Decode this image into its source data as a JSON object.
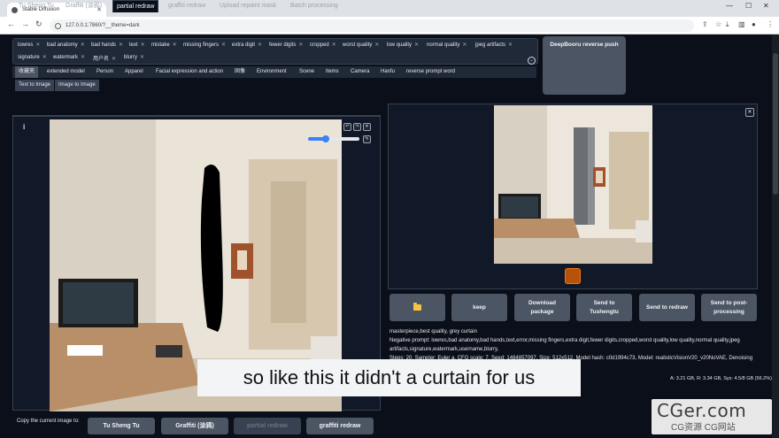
{
  "browser": {
    "tab_title": "Stable Diffusion",
    "url": "127.0.0.1:7860/?__theme=dark"
  },
  "prompt_tags": [
    {
      "label": "lowres"
    },
    {
      "label": "bad anatomy"
    },
    {
      "label": "bad hands"
    },
    {
      "label": "text"
    },
    {
      "label": "mistake"
    },
    {
      "label": "missing fingers"
    },
    {
      "label": "extra digit"
    },
    {
      "label": "fewer digits"
    },
    {
      "label": "cropped"
    },
    {
      "label": "worst quality"
    },
    {
      "label": "low quality"
    },
    {
      "label": "normal quality"
    },
    {
      "label": "jpeg artifacts"
    },
    {
      "label": "signature"
    },
    {
      "label": "watermark"
    },
    {
      "label": "用户名"
    },
    {
      "label": "blurry"
    }
  ],
  "deepbooru_button": "DeepBooru reverse push",
  "categories": [
    "收藏夹",
    "extended model",
    "Person",
    "Apparel",
    "Facial expression and action",
    "固像",
    "Environment",
    "Scene",
    "Items",
    "Camera",
    "Hanfu",
    "reverse prompt word"
  ],
  "transfer_buttons": [
    "Text to Image",
    "Image to Image"
  ],
  "main_tabs": [
    "Tu Sheng Tu",
    "Graffiti (涂鸦)",
    "partial redraw",
    "graffiti redraw",
    "Upload repaint mask",
    "Batch processing"
  ],
  "active_tab": "partial redraw",
  "brush_slider_value": 0.35,
  "copy_row": {
    "label": "Copy the current image to:",
    "buttons": [
      "Tu Sheng Tu",
      "Graffiti (涂鸦)",
      "partial redraw",
      "graffiti redraw"
    ]
  },
  "actions": [
    "keep",
    "Download package",
    "Send to Tushengtu",
    "Send to redraw",
    "Send to post-processing"
  ],
  "gen_info": {
    "line1": "masterpiece,best quality, grey curtain",
    "line2": "Negative prompt: lowres,bad anatomy,bad hands,text,error,missing fingers,extra digit,fewer digits,cropped,worst quality,low quality,normal quality,jpeg",
    "line3": "artifacts,signature,watermark,username,blurry,",
    "line4": "Steps: 20, Sampler: Euler a, CFG scale: 7, Seed: 1484857097, Size: 512x512, Model hash: c0d1994c73, Model: realisticVisionV20_v20NoVAE, Denoising"
  },
  "memory": "A: 3.21 GB, R: 3.34 GB, Sys: 4.5/8 GB (56.2%)",
  "subtitle": "so like this it didn't a curtain for us",
  "watermark": {
    "top": "CGer.com",
    "bottom": "CG资源  CG网站"
  },
  "icons": [
    "folder-icon",
    "undo-icon",
    "redo-icon",
    "close-icon",
    "brush-icon",
    "chevron-down-icon",
    "info-icon"
  ]
}
